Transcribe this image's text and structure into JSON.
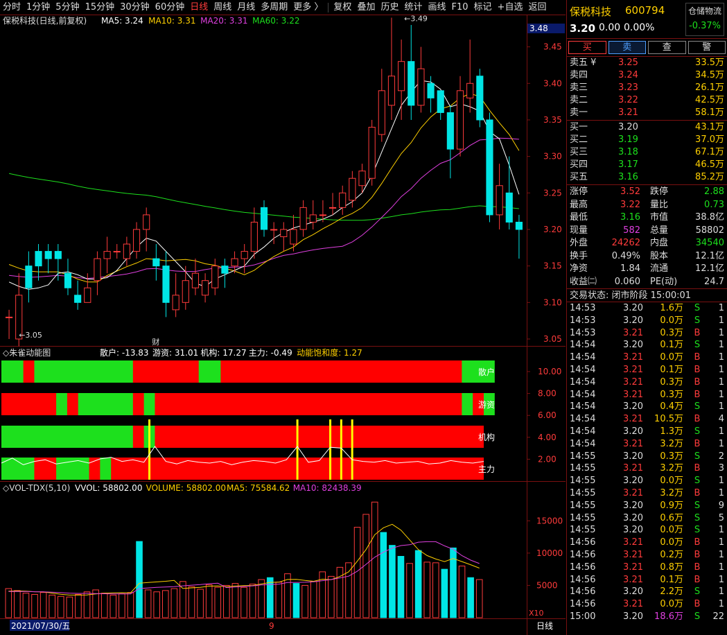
{
  "toolbar": {
    "periods": [
      "分时",
      "1分钟",
      "5分钟",
      "15分钟",
      "30分钟",
      "60分钟",
      "日线",
      "周线",
      "月线",
      "多周期",
      "更多 〉"
    ],
    "active_period": "日线",
    "tools": [
      "复权",
      "叠加",
      "历史",
      "统计",
      "画线",
      "F10",
      "标记",
      "+自选",
      "返回"
    ]
  },
  "kline": {
    "title": "保税科技(日线,前复权)",
    "ma": [
      {
        "label": "MA5: 3.24",
        "color": "#ffffff"
      },
      {
        "label": "MA10: 3.31",
        "color": "#ffd000"
      },
      {
        "label": "MA20: 3.31",
        "color": "#e040e0"
      },
      {
        "label": "MA60: 3.22",
        "color": "#1de01d"
      }
    ],
    "current_price_tag": "3.48",
    "high_mark": "3.49",
    "low_mark": "3.05",
    "cai_mark": "财",
    "ylim": [
      3.05,
      3.48
    ],
    "yticks": [
      "3.45",
      "3.40",
      "3.35",
      "3.30",
      "3.25",
      "3.20",
      "3.15",
      "3.10",
      "3.05"
    ],
    "candles": [
      [
        3.08,
        3.08,
        3.05,
        3.09
      ],
      [
        3.05,
        3.11,
        3.04,
        3.14
      ],
      [
        3.15,
        3.12,
        3.1,
        3.17
      ],
      [
        3.17,
        3.15,
        3.13,
        3.18
      ],
      [
        3.17,
        3.16,
        3.14,
        3.18
      ],
      [
        3.17,
        3.16,
        3.13,
        3.18
      ],
      [
        3.14,
        3.12,
        3.11,
        3.16
      ],
      [
        3.11,
        3.1,
        3.09,
        3.13
      ],
      [
        3.1,
        3.12,
        3.1,
        3.14
      ],
      [
        3.13,
        3.16,
        3.11,
        3.17
      ],
      [
        3.16,
        3.17,
        3.14,
        3.19
      ],
      [
        3.17,
        3.17,
        3.16,
        3.18
      ],
      [
        3.16,
        3.18,
        3.15,
        3.19
      ],
      [
        3.17,
        3.2,
        3.16,
        3.21
      ],
      [
        3.2,
        3.22,
        3.17,
        3.23
      ],
      [
        3.16,
        3.15,
        3.13,
        3.18
      ],
      [
        3.15,
        3.1,
        3.08,
        3.17
      ],
      [
        3.09,
        3.11,
        3.08,
        3.14
      ],
      [
        3.1,
        3.13,
        3.09,
        3.15
      ],
      [
        3.12,
        3.14,
        3.11,
        3.16
      ],
      [
        3.11,
        3.13,
        3.1,
        3.14
      ],
      [
        3.12,
        3.15,
        3.11,
        3.16
      ],
      [
        3.15,
        3.14,
        3.12,
        3.16
      ],
      [
        3.15,
        3.16,
        3.14,
        3.17
      ],
      [
        3.16,
        3.17,
        3.14,
        3.18
      ],
      [
        3.17,
        3.21,
        3.16,
        3.23
      ],
      [
        3.23,
        3.2,
        3.19,
        3.24
      ],
      [
        3.2,
        3.2,
        3.18,
        3.21
      ],
      [
        3.19,
        3.2,
        3.17,
        3.21
      ],
      [
        3.18,
        3.2,
        3.17,
        3.22
      ],
      [
        3.2,
        3.23,
        3.19,
        3.24
      ],
      [
        3.21,
        3.22,
        3.2,
        3.24
      ],
      [
        3.22,
        3.22,
        3.21,
        3.24
      ],
      [
        3.23,
        3.23,
        3.22,
        3.25
      ],
      [
        3.23,
        3.25,
        3.22,
        3.26
      ],
      [
        3.24,
        3.27,
        3.23,
        3.28
      ],
      [
        3.26,
        3.28,
        3.25,
        3.29
      ],
      [
        3.27,
        3.34,
        3.26,
        3.35
      ],
      [
        3.33,
        3.39,
        3.32,
        3.42
      ],
      [
        3.37,
        3.41,
        3.35,
        3.49
      ],
      [
        3.39,
        3.43,
        3.35,
        3.46
      ],
      [
        3.43,
        3.37,
        3.35,
        3.48
      ],
      [
        3.37,
        3.42,
        3.36,
        3.45
      ],
      [
        3.4,
        3.38,
        3.36,
        3.41
      ],
      [
        3.39,
        3.36,
        3.35,
        3.39
      ],
      [
        3.36,
        3.31,
        3.27,
        3.37
      ],
      [
        3.31,
        3.39,
        3.3,
        3.41
      ],
      [
        3.38,
        3.4,
        3.36,
        3.46
      ],
      [
        3.41,
        3.35,
        3.34,
        3.42
      ],
      [
        3.35,
        3.22,
        3.21,
        3.36
      ],
      [
        3.22,
        3.26,
        3.2,
        3.29
      ],
      [
        3.25,
        3.21,
        3.2,
        3.3
      ],
      [
        3.21,
        3.2,
        3.16,
        3.22
      ]
    ]
  },
  "zq": {
    "title": "朱雀动能图",
    "values": [
      {
        "label": "散户: -13.83",
        "color": "#ffffff"
      },
      {
        "label": "游资: 31.01",
        "color": "#ffffff"
      },
      {
        "label": "机构: 17.27",
        "color": "#ffffff"
      },
      {
        "label": "主力: -0.49",
        "color": "#ffffff"
      },
      {
        "label": "动能饱和度: 1.27",
        "color": "#ffd000"
      }
    ],
    "rows": [
      "散户",
      "游资",
      "机构",
      "主力"
    ],
    "yticks": [
      "10.00",
      "8.00",
      "6.00",
      "4.00",
      "2.00"
    ]
  },
  "vol": {
    "title": "VOL-TDX(5,10)",
    "items": [
      {
        "label": "VVOL: 58802.00",
        "color": "#ffffff"
      },
      {
        "label": "VOLUME: 58802.00",
        "color": "#ffd000"
      },
      {
        "label": "MA5: 75584.62",
        "color": "#ffd000"
      },
      {
        "label": "MA10: 82438.39",
        "color": "#e040e0"
      }
    ],
    "yticks": [
      "15000",
      "10000",
      "5000"
    ],
    "unit": "X10",
    "values": [
      4500,
      4200,
      3800,
      3600,
      3900,
      3500,
      3300,
      3200,
      3600,
      4000,
      4300,
      3800,
      3500,
      3700,
      3900,
      11800,
      4300,
      4000,
      4200,
      4500,
      5600,
      4800,
      4400,
      5100,
      4700,
      5000,
      5300,
      4700,
      5200,
      5900,
      6200,
      5500,
      6800,
      5300,
      5000,
      5600,
      7100,
      6400,
      7800,
      8500,
      14000,
      16000,
      17900,
      13200,
      11200,
      9500,
      8400,
      10400,
      8600,
      8500,
      7500,
      10800,
      8000,
      6200,
      5900
    ],
    "down": [
      0,
      0,
      0,
      0,
      0,
      0,
      0,
      0,
      0,
      0,
      0,
      0,
      0,
      0,
      0,
      1,
      0,
      0,
      0,
      0,
      0,
      0,
      0,
      0,
      0,
      0,
      0,
      0,
      0,
      0,
      1,
      0,
      0,
      1,
      0,
      0,
      0,
      0,
      0,
      0,
      0,
      0,
      0,
      1,
      1,
      1,
      0,
      1,
      0,
      0,
      1,
      1,
      0,
      1,
      0
    ]
  },
  "bottom": {
    "date": "2021/07/30/五",
    "marker": "9",
    "period": "日线"
  },
  "stock": {
    "name": "保税科技",
    "code": "600794",
    "price": "3.20",
    "change": "0.00",
    "pct": "0.00%",
    "sector": "仓储物流",
    "sector_pct": "-0.37%"
  },
  "trade": [
    "买",
    "卖",
    "查",
    "警"
  ],
  "orderbook": {
    "asks": [
      {
        "label": "卖五 ¥",
        "price": "3.25",
        "vol": "33.5万"
      },
      {
        "label": "卖四",
        "price": "3.24",
        "vol": "34.5万"
      },
      {
        "label": "卖三",
        "price": "3.23",
        "vol": "26.1万"
      },
      {
        "label": "卖二",
        "price": "3.22",
        "vol": "42.5万"
      },
      {
        "label": "卖一",
        "price": "3.21",
        "vol": "58.1万"
      }
    ],
    "bids": [
      {
        "label": "买一",
        "price": "3.20",
        "vol": "43.1万",
        "color": "white"
      },
      {
        "label": "买二",
        "price": "3.19",
        "vol": "37.0万",
        "color": "green"
      },
      {
        "label": "买三",
        "price": "3.18",
        "vol": "67.1万",
        "color": "green"
      },
      {
        "label": "买四",
        "price": "3.17",
        "vol": "46.5万",
        "color": "green"
      },
      {
        "label": "买五",
        "price": "3.16",
        "vol": "85.2万",
        "color": "green"
      }
    ]
  },
  "stats": [
    [
      {
        "l": "涨停",
        "v": "3.52",
        "c": "red"
      },
      {
        "l": "跌停",
        "v": "2.88",
        "c": "green"
      }
    ],
    [
      {
        "l": "最高",
        "v": "3.22",
        "c": "red"
      },
      {
        "l": "量比",
        "v": "0.73",
        "c": "green"
      }
    ],
    [
      {
        "l": "最低",
        "v": "3.16",
        "c": "green"
      },
      {
        "l": "市值",
        "v": "38.8亿",
        "c": "white"
      }
    ],
    [
      {
        "l": "现量",
        "v": "582",
        "c": "mag"
      },
      {
        "l": "总量",
        "v": "58802",
        "c": "white"
      }
    ],
    [
      {
        "l": "外盘",
        "v": "24262",
        "c": "red"
      },
      {
        "l": "内盘",
        "v": "34540",
        "c": "green"
      }
    ],
    [
      {
        "l": "换手",
        "v": "0.49%",
        "c": "white"
      },
      {
        "l": "股本",
        "v": "12.1亿",
        "c": "white"
      }
    ],
    [
      {
        "l": "净资",
        "v": "1.84",
        "c": "white"
      },
      {
        "l": "流通",
        "v": "12.1亿",
        "c": "white"
      }
    ],
    [
      {
        "l": "收益㈡",
        "v": "0.060",
        "c": "white"
      },
      {
        "l": "PE(动)",
        "v": "24.7",
        "c": "white"
      }
    ]
  ],
  "trade_status": "交易状态: 闭市阶段 15:00:01",
  "ticks": [
    [
      "14:53",
      "3.20",
      "1.6万",
      "S",
      "1"
    ],
    [
      "14:53",
      "3.20",
      "0.0万",
      "S",
      "1"
    ],
    [
      "14:53",
      "3.21",
      "0.3万",
      "B",
      "1"
    ],
    [
      "14:54",
      "3.20",
      "0.1万",
      "S",
      "1"
    ],
    [
      "14:54",
      "3.21",
      "0.0万",
      "B",
      "1"
    ],
    [
      "14:54",
      "3.21",
      "0.1万",
      "B",
      "1"
    ],
    [
      "14:54",
      "3.21",
      "0.3万",
      "B",
      "1"
    ],
    [
      "14:54",
      "3.21",
      "0.3万",
      "B",
      "1"
    ],
    [
      "14:54",
      "3.20",
      "0.4万",
      "S",
      "1"
    ],
    [
      "14:54",
      "3.21",
      "10.5万",
      "B",
      "4"
    ],
    [
      "14:54",
      "3.20",
      "1.3万",
      "S",
      "1"
    ],
    [
      "14:54",
      "3.21",
      "3.2万",
      "B",
      "1"
    ],
    [
      "14:55",
      "3.20",
      "0.3万",
      "S",
      "2"
    ],
    [
      "14:55",
      "3.21",
      "3.2万",
      "B",
      "3"
    ],
    [
      "14:55",
      "3.20",
      "0.0万",
      "S",
      "1"
    ],
    [
      "14:55",
      "3.21",
      "3.2万",
      "B",
      "1"
    ],
    [
      "14:55",
      "3.20",
      "0.9万",
      "S",
      "9"
    ],
    [
      "14:55",
      "3.20",
      "0.6万",
      "S",
      "5"
    ],
    [
      "14:55",
      "3.20",
      "0.0万",
      "S",
      "1"
    ],
    [
      "14:56",
      "3.21",
      "0.0万",
      "B",
      "1"
    ],
    [
      "14:56",
      "3.21",
      "0.2万",
      "B",
      "1"
    ],
    [
      "14:56",
      "3.21",
      "0.8万",
      "B",
      "1"
    ],
    [
      "14:56",
      "3.21",
      "0.1万",
      "B",
      "1"
    ],
    [
      "14:56",
      "3.20",
      "2.2万",
      "S",
      "1"
    ],
    [
      "14:56",
      "3.21",
      "0.0万",
      "B",
      "1"
    ],
    [
      "15:00",
      "3.20",
      "18.6万",
      "S",
      "22"
    ]
  ],
  "colors": {
    "up": "#ff3b3b",
    "down": "#00e5e5",
    "ma5": "#ffffff",
    "ma10": "#ffd000",
    "ma20": "#e040e0",
    "ma60": "#1de01d",
    "border": "#7a1010"
  }
}
